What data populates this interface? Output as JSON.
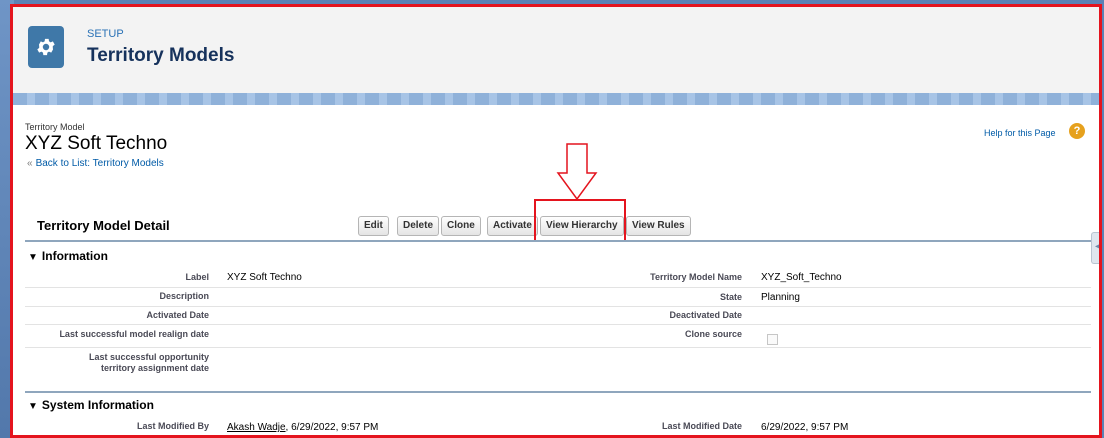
{
  "header": {
    "setup_label": "SETUP",
    "title": "Territory Models",
    "icon": "gear-icon"
  },
  "record": {
    "type_label": "Territory Model",
    "name": "XYZ Soft Techno",
    "back_link": "Back to List: Territory Models",
    "help_link": "Help for this Page",
    "help_icon": "question-icon"
  },
  "detail": {
    "title": "Territory Model Detail",
    "buttons": {
      "edit": "Edit",
      "delete": "Delete",
      "clone": "Clone",
      "activate": "Activate",
      "view_hierarchy": "View Hierarchy",
      "view_rules": "View Rules"
    }
  },
  "information": {
    "title": "Information",
    "label_lbl": "Label",
    "label_val": "XYZ Soft Techno",
    "model_name_lbl": "Territory Model Name",
    "model_name_val": "XYZ_Soft_Techno",
    "description_lbl": "Description",
    "state_lbl": "State",
    "state_val": "Planning",
    "activated_lbl": "Activated Date",
    "deactivated_lbl": "Deactivated Date",
    "realign_lbl": "Last successful model realign date",
    "clone_source_lbl": "Clone source",
    "opp_lbl_1": "Last successful opportunity",
    "opp_lbl_2": "territory assignment date"
  },
  "system": {
    "title": "System Information",
    "modified_by_lbl": "Last Modified By",
    "modified_by_user": "Akash Wadje",
    "modified_by_date": ", 6/29/2022, 9:57 PM",
    "modified_date_lbl": "Last Modified Date",
    "modified_date_val": "6/29/2022, 9:57 PM"
  },
  "colors": {
    "highlight": "#e4141e",
    "link": "#015ba7",
    "brand_icon": "#3f78a8"
  }
}
